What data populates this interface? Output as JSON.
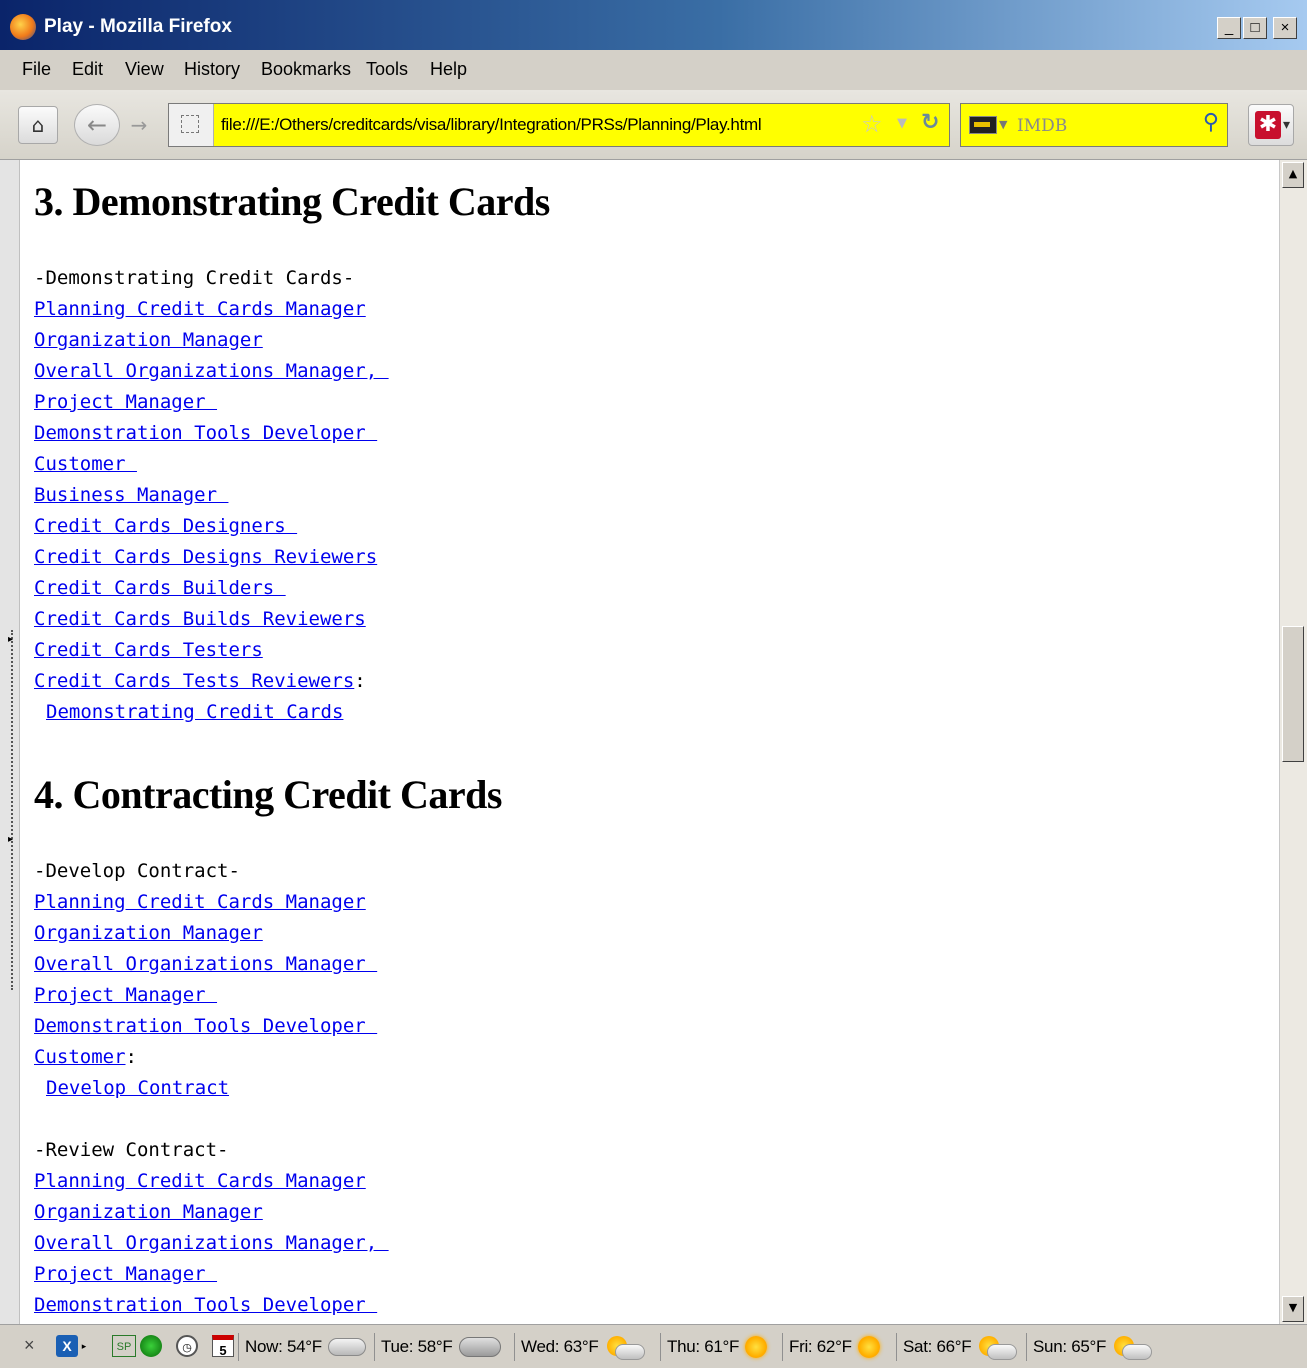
{
  "window": {
    "title": "Play - Mozilla Firefox",
    "min": "_",
    "max": "□",
    "close": "×"
  },
  "menu": [
    "File",
    "Edit",
    "View",
    "History",
    "Bookmarks",
    "Tools",
    "Help"
  ],
  "toolbar": {
    "url": "file:///E:/Others/creditcards/visa/library/Integration/PRSs/Planning/Play.html",
    "search_placeholder": "IMDB"
  },
  "sections": [
    {
      "heading": "3. Demonstrating Credit Cards",
      "blocks": [
        {
          "title": "-Demonstrating Credit Cards-",
          "links": [
            "Planning Credit Cards Manager",
            "Organization Manager",
            "Overall Organizations Manager, ",
            "Project Manager ",
            "Demonstration Tools Developer ",
            "Customer ",
            "Business Manager ",
            "Credit Cards Designers ",
            "Credit Cards Designs Reviewers",
            "Credit Cards Builders ",
            "Credit Cards Builds Reviewers",
            "Credit Cards Testers",
            "Credit Cards Tests Reviewers"
          ],
          "suffix": ":",
          "action": "Demonstrating Credit Cards"
        }
      ]
    },
    {
      "heading": "4. Contracting Credit Cards",
      "blocks": [
        {
          "title": "-Develop Contract-",
          "links": [
            "Planning Credit Cards Manager",
            "Organization Manager",
            "Overall Organizations Manager ",
            "Project Manager ",
            "Demonstration Tools Developer ",
            "Customer"
          ],
          "suffix": ":",
          "action": "Develop Contract"
        },
        {
          "title": "-Review Contract-",
          "links": [
            "Planning Credit Cards Manager",
            "Organization Manager",
            "Overall Organizations Manager, ",
            "Project Manager ",
            "Demonstration Tools Developer "
          ]
        }
      ]
    }
  ],
  "status": {
    "weather": [
      {
        "label": "Now: 54°F",
        "icon": "cloud-icon"
      },
      {
        "label": "Tue: 58°F",
        "icon": "rain-cloud-icon"
      },
      {
        "label": "Wed: 63°F",
        "icon": "partly-sunny-icon"
      },
      {
        "label": "Thu: 61°F",
        "icon": "sun-icon"
      },
      {
        "label": "Fri: 62°F",
        "icon": "sun-icon"
      },
      {
        "label": "Sat: 66°F",
        "icon": "partly-sunny-icon"
      },
      {
        "label": "Sun: 65°F",
        "icon": "partly-sunny-icon"
      }
    ],
    "calendar_day": "5",
    "sp_label": "SP"
  },
  "colors": {
    "link": "#0000ee",
    "highlight": "#ffff00"
  }
}
